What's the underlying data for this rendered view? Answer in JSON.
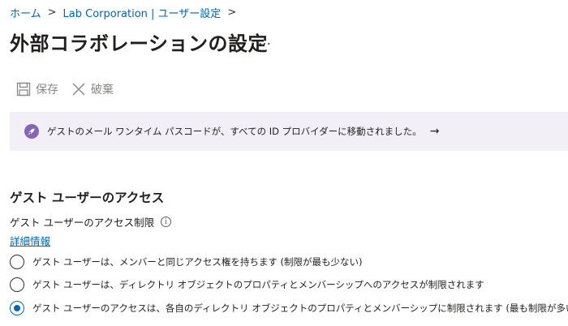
{
  "breadcrumb": {
    "items": [
      "ホーム",
      "Lab Corporation | ユーザー設定"
    ],
    "separator": ">"
  },
  "page": {
    "title": "外部コラボレーションの設定",
    "more_label": "…"
  },
  "toolbar": {
    "save_label": "保存",
    "save_icon": "save-icon",
    "discard_label": "破棄",
    "discard_icon": "close-icon"
  },
  "banner": {
    "icon": "rocket-icon",
    "text": "ゲストのメール ワンタイム パスコードが、すべての ID プロバイダーに移動されました。",
    "arrow": "→",
    "background": "#f3eff7",
    "accent": "#8764b8"
  },
  "guest_access": {
    "heading": "ゲスト ユーザーのアクセス",
    "restriction_label": "ゲスト ユーザーのアクセス制限",
    "details_link": "詳細情報",
    "options": [
      {
        "label": "ゲスト ユーザーは、メンバーと同じアクセス権を持ちます (制限が最も少ない)",
        "selected": false
      },
      {
        "label": "ゲスト ユーザーは、ディレクトリ オブジェクトのプロパティとメンバーシップへのアクセスが制限されます",
        "selected": false
      },
      {
        "label": "ゲスト ユーザーのアクセスは、各自のディレクトリ オブジェクトのプロパティとメンバーシップに制限されます (最も制限が多い)",
        "selected": true
      }
    ]
  },
  "colors": {
    "link": "#0067b8",
    "disabled_text": "#8a8886"
  }
}
